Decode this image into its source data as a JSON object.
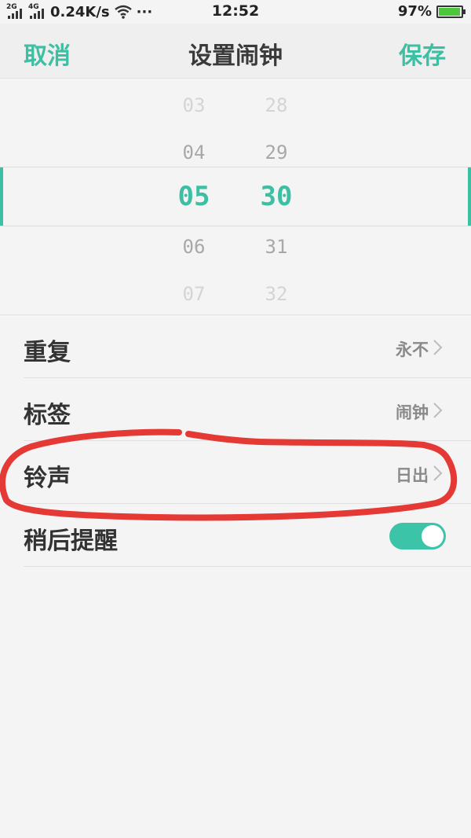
{
  "status_bar": {
    "sim1_tag": "2G",
    "sim2_tag": "4G",
    "speed": "0.24K/s",
    "more": "···",
    "time": "12:52",
    "battery_pct": "97%",
    "battery_level": 0.97
  },
  "header": {
    "cancel_label": "取消",
    "title": "设置闹钟",
    "save_label": "保存"
  },
  "picker": {
    "hours": [
      "03",
      "04",
      "05",
      "06",
      "07"
    ],
    "minutes": [
      "28",
      "29",
      "30",
      "31",
      "32"
    ],
    "selected_hour": "05",
    "selected_minute": "30"
  },
  "settings": {
    "repeat": {
      "label": "重复",
      "value": "永不"
    },
    "tag": {
      "label": "标签",
      "value": "闹钟"
    },
    "ringtone": {
      "label": "铃声",
      "value": "日出"
    },
    "snooze": {
      "label": "稍后提醒",
      "enabled": true
    }
  },
  "colors": {
    "accent": "#3cbfa3",
    "annotation": "#e53935"
  }
}
